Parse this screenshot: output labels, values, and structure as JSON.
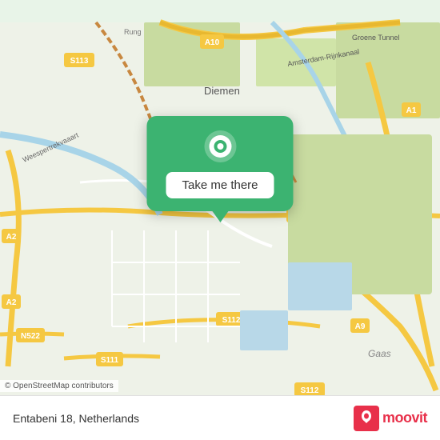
{
  "map": {
    "alt": "Map of Amsterdam area showing Entabeni 18, Netherlands",
    "background_color": "#e8f0e8"
  },
  "popup": {
    "button_label": "Take me there",
    "pin_icon": "location-pin"
  },
  "attribution": {
    "text": "© OpenStreetMap contributors"
  },
  "bottom_bar": {
    "address": "Entabeni 18, Netherlands",
    "logo_text": "moovit"
  },
  "colors": {
    "green": "#3cb371",
    "red": "#e8304a",
    "white": "#ffffff"
  }
}
